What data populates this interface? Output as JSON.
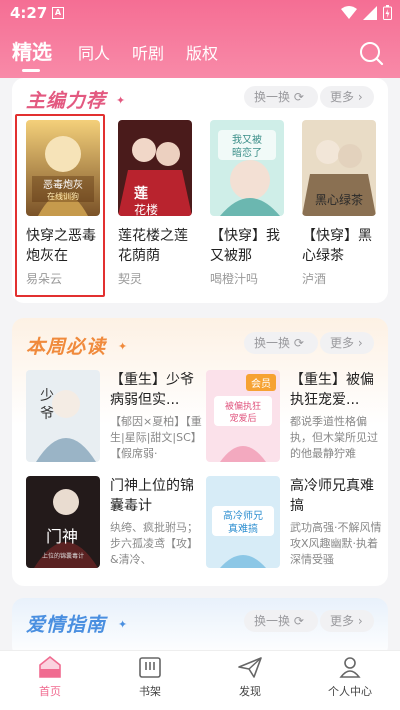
{
  "status": {
    "time": "4:27",
    "app_badge": "A"
  },
  "nav": {
    "tabs": [
      "精选",
      "同人",
      "听剧",
      "版权"
    ]
  },
  "sections": {
    "editor": {
      "title": "主编力荐",
      "swap": "换一换",
      "more": "更多",
      "books": [
        {
          "title": "快穿之恶毒炮灰在",
          "author": "易朵云",
          "cover_text": "快穿之恶毒炮灰在线训狗"
        },
        {
          "title": "莲花楼之莲花荫荫",
          "author": "契灵",
          "cover_text": "莲花楼"
        },
        {
          "title": "【快穿】我又被那",
          "author": "喝橙汁吗",
          "cover_text": "我又被暗恋了"
        },
        {
          "title": "【快穿】黑心绿茶",
          "author": "泸酒",
          "cover_text": "黑心绿茶"
        }
      ]
    },
    "weekly": {
      "title": "本周必读",
      "swap": "换一换",
      "more": "更多",
      "items": [
        {
          "title": "【重生】少爷病弱但实...",
          "desc": "【郁因×夏柏】【重生|星际|甜文|SC】【假席弱·",
          "cover_text": "少爷"
        },
        {
          "title": "【重生】被偏执狂宠爱...",
          "desc": "都说季道性格偏执，但木棠所见过的他最静狞难",
          "badge": "会员",
          "cover_text": "被偏执狂宠爱后"
        },
        {
          "title": "门神上位的锦囊毒计",
          "desc": "纨绔、疯批驸马；步六孤凌鸢【攻】&清冷、",
          "cover_text": "门神 上位的锦囊毒计"
        },
        {
          "title": "高冷师兄真难搞",
          "desc": "武功高强·不解风情攻X风趣幽默·执着深情受骚",
          "cover_text": "高冷师兄真难搞"
        }
      ]
    },
    "romance": {
      "title": "爱情指南",
      "swap": "换一换",
      "more": "更多"
    }
  },
  "bottom_nav": [
    "首页",
    "书架",
    "发现",
    "个人中心"
  ],
  "colors": {
    "brand_pink": "#f56e94",
    "editor_title": "#e35980",
    "weekly_title": "#f08a3c",
    "romance_title": "#4a8fe0"
  }
}
